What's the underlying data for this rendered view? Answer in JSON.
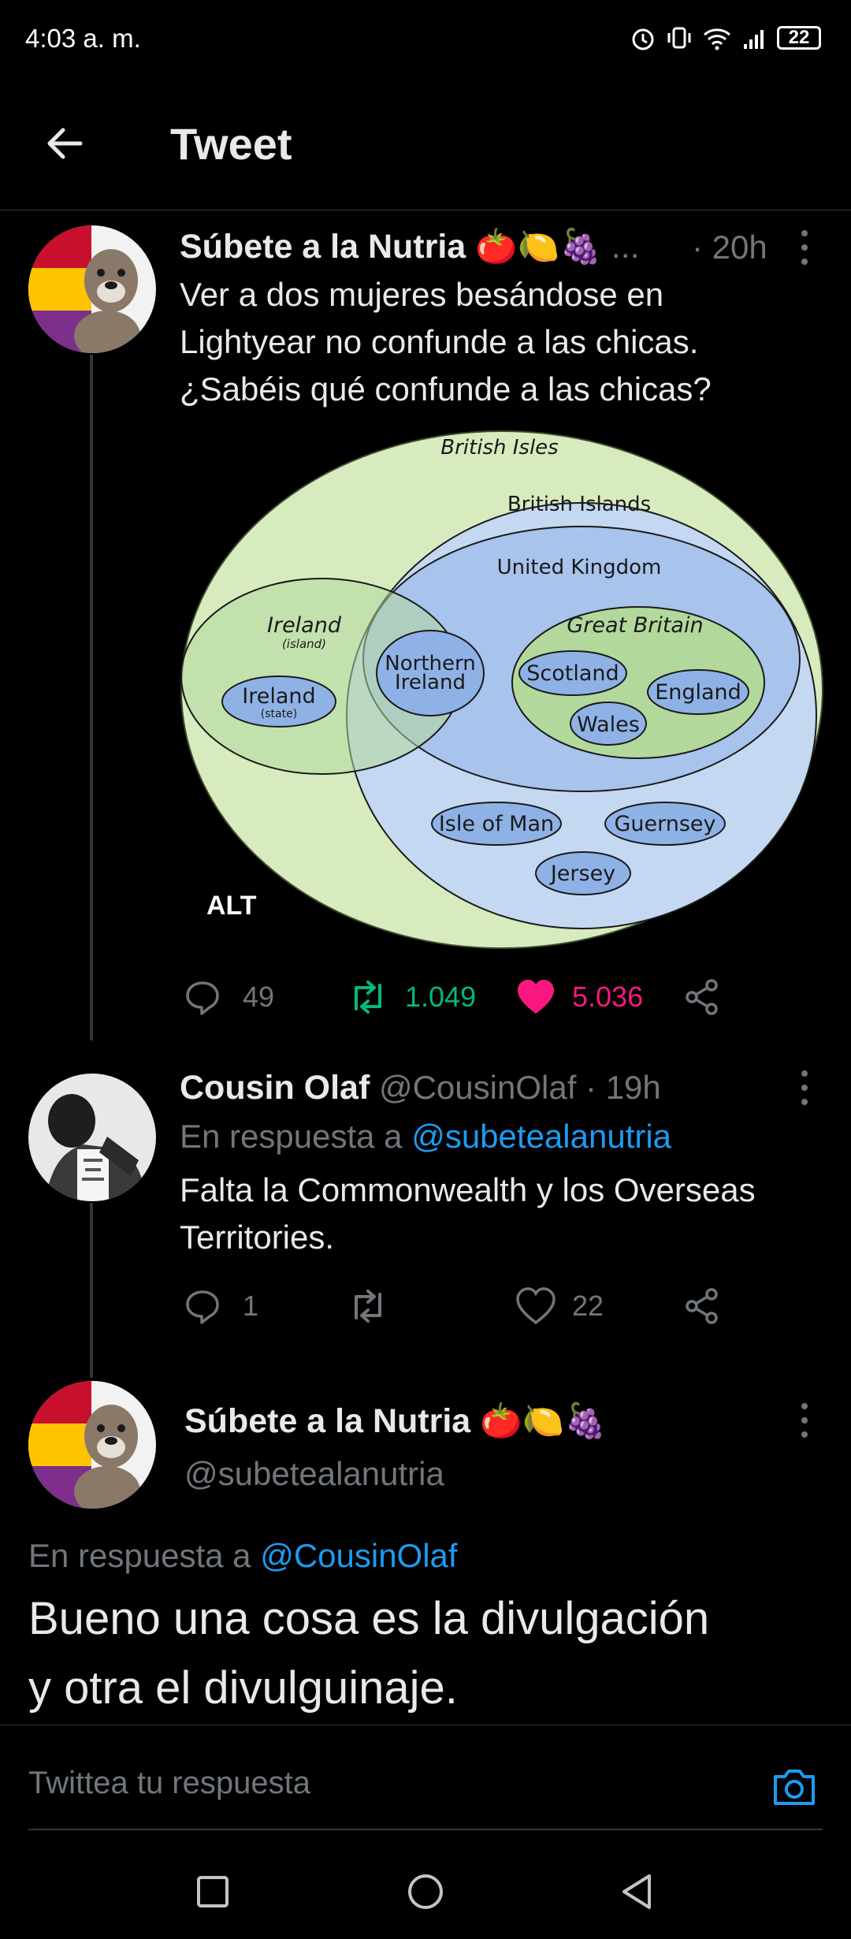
{
  "status_bar": {
    "time": "4:03 a. m.",
    "battery": "22"
  },
  "header": {
    "title": "Tweet"
  },
  "tweet": {
    "author_name": "Súbete a la Nutria",
    "emojis": "🍅🍋🍇",
    "ellipsis": "...",
    "time": "· 20h",
    "text_lines": [
      "Ver a dos mujeres besándose en",
      "Lightyear no confunde a las chicas.",
      "¿Sabéis qué confunde a las chicas?"
    ],
    "alt_badge": "ALT",
    "replies": "49",
    "retweets": "1.049",
    "likes": "5.036",
    "colors": {
      "retweet": "#00ba7c",
      "like": "#f91880"
    }
  },
  "diagram": {
    "british_isles": "British Isles",
    "british_islands": "British Islands",
    "united_kingdom": "United Kingdom",
    "ireland_island": "Ireland",
    "ireland_island_sub": "(island)",
    "ireland_state": "Ireland",
    "ireland_state_sub": "(state)",
    "northern_ireland_1": "Northern",
    "northern_ireland_2": "Ireland",
    "great_britain": "Great Britain",
    "scotland": "Scotland",
    "england": "England",
    "wales": "Wales",
    "isle_of_man": "Isle of Man",
    "guernsey": "Guernsey",
    "jersey": "Jersey"
  },
  "reply1": {
    "author_name": "Cousin Olaf",
    "handle_time": "@CousinOlaf · 19h",
    "reply_to_prefix": "En respuesta a",
    "reply_to_handle": "@subetealanutria",
    "text_lines": [
      "Falta la Commonwealth y los Overseas",
      "Territories."
    ],
    "replies": "1",
    "likes": "22"
  },
  "main_tweet": {
    "author_name": "Súbete a la Nutria",
    "emojis": "🍅🍋🍇",
    "handle": "@subetealanutria",
    "reply_to_prefix": "En respuesta a",
    "reply_to_handle": "@CousinOlaf",
    "text_lines": [
      "Bueno una cosa es la divulgación",
      "y otra el divulguinaje."
    ]
  },
  "composer": {
    "placeholder": "Twittea tu respuesta"
  }
}
